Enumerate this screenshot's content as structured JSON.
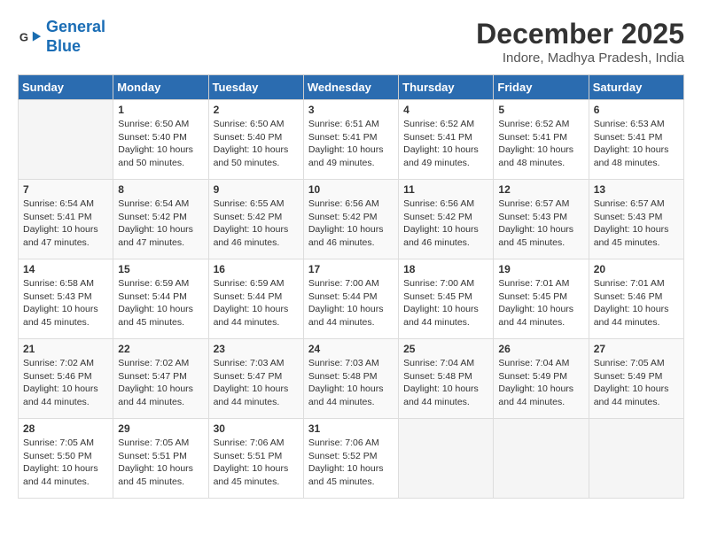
{
  "logo": {
    "line1": "General",
    "line2": "Blue"
  },
  "title": "December 2025",
  "subtitle": "Indore, Madhya Pradesh, India",
  "days_of_week": [
    "Sunday",
    "Monday",
    "Tuesday",
    "Wednesday",
    "Thursday",
    "Friday",
    "Saturday"
  ],
  "weeks": [
    [
      {
        "day": "",
        "info": ""
      },
      {
        "day": "1",
        "info": "Sunrise: 6:50 AM\nSunset: 5:40 PM\nDaylight: 10 hours\nand 50 minutes."
      },
      {
        "day": "2",
        "info": "Sunrise: 6:50 AM\nSunset: 5:40 PM\nDaylight: 10 hours\nand 50 minutes."
      },
      {
        "day": "3",
        "info": "Sunrise: 6:51 AM\nSunset: 5:41 PM\nDaylight: 10 hours\nand 49 minutes."
      },
      {
        "day": "4",
        "info": "Sunrise: 6:52 AM\nSunset: 5:41 PM\nDaylight: 10 hours\nand 49 minutes."
      },
      {
        "day": "5",
        "info": "Sunrise: 6:52 AM\nSunset: 5:41 PM\nDaylight: 10 hours\nand 48 minutes."
      },
      {
        "day": "6",
        "info": "Sunrise: 6:53 AM\nSunset: 5:41 PM\nDaylight: 10 hours\nand 48 minutes."
      }
    ],
    [
      {
        "day": "7",
        "info": "Sunrise: 6:54 AM\nSunset: 5:41 PM\nDaylight: 10 hours\nand 47 minutes."
      },
      {
        "day": "8",
        "info": "Sunrise: 6:54 AM\nSunset: 5:42 PM\nDaylight: 10 hours\nand 47 minutes."
      },
      {
        "day": "9",
        "info": "Sunrise: 6:55 AM\nSunset: 5:42 PM\nDaylight: 10 hours\nand 46 minutes."
      },
      {
        "day": "10",
        "info": "Sunrise: 6:56 AM\nSunset: 5:42 PM\nDaylight: 10 hours\nand 46 minutes."
      },
      {
        "day": "11",
        "info": "Sunrise: 6:56 AM\nSunset: 5:42 PM\nDaylight: 10 hours\nand 46 minutes."
      },
      {
        "day": "12",
        "info": "Sunrise: 6:57 AM\nSunset: 5:43 PM\nDaylight: 10 hours\nand 45 minutes."
      },
      {
        "day": "13",
        "info": "Sunrise: 6:57 AM\nSunset: 5:43 PM\nDaylight: 10 hours\nand 45 minutes."
      }
    ],
    [
      {
        "day": "14",
        "info": "Sunrise: 6:58 AM\nSunset: 5:43 PM\nDaylight: 10 hours\nand 45 minutes."
      },
      {
        "day": "15",
        "info": "Sunrise: 6:59 AM\nSunset: 5:44 PM\nDaylight: 10 hours\nand 45 minutes."
      },
      {
        "day": "16",
        "info": "Sunrise: 6:59 AM\nSunset: 5:44 PM\nDaylight: 10 hours\nand 44 minutes."
      },
      {
        "day": "17",
        "info": "Sunrise: 7:00 AM\nSunset: 5:44 PM\nDaylight: 10 hours\nand 44 minutes."
      },
      {
        "day": "18",
        "info": "Sunrise: 7:00 AM\nSunset: 5:45 PM\nDaylight: 10 hours\nand 44 minutes."
      },
      {
        "day": "19",
        "info": "Sunrise: 7:01 AM\nSunset: 5:45 PM\nDaylight: 10 hours\nand 44 minutes."
      },
      {
        "day": "20",
        "info": "Sunrise: 7:01 AM\nSunset: 5:46 PM\nDaylight: 10 hours\nand 44 minutes."
      }
    ],
    [
      {
        "day": "21",
        "info": "Sunrise: 7:02 AM\nSunset: 5:46 PM\nDaylight: 10 hours\nand 44 minutes."
      },
      {
        "day": "22",
        "info": "Sunrise: 7:02 AM\nSunset: 5:47 PM\nDaylight: 10 hours\nand 44 minutes."
      },
      {
        "day": "23",
        "info": "Sunrise: 7:03 AM\nSunset: 5:47 PM\nDaylight: 10 hours\nand 44 minutes."
      },
      {
        "day": "24",
        "info": "Sunrise: 7:03 AM\nSunset: 5:48 PM\nDaylight: 10 hours\nand 44 minutes."
      },
      {
        "day": "25",
        "info": "Sunrise: 7:04 AM\nSunset: 5:48 PM\nDaylight: 10 hours\nand 44 minutes."
      },
      {
        "day": "26",
        "info": "Sunrise: 7:04 AM\nSunset: 5:49 PM\nDaylight: 10 hours\nand 44 minutes."
      },
      {
        "day": "27",
        "info": "Sunrise: 7:05 AM\nSunset: 5:49 PM\nDaylight: 10 hours\nand 44 minutes."
      }
    ],
    [
      {
        "day": "28",
        "info": "Sunrise: 7:05 AM\nSunset: 5:50 PM\nDaylight: 10 hours\nand 44 minutes."
      },
      {
        "day": "29",
        "info": "Sunrise: 7:05 AM\nSunset: 5:51 PM\nDaylight: 10 hours\nand 45 minutes."
      },
      {
        "day": "30",
        "info": "Sunrise: 7:06 AM\nSunset: 5:51 PM\nDaylight: 10 hours\nand 45 minutes."
      },
      {
        "day": "31",
        "info": "Sunrise: 7:06 AM\nSunset: 5:52 PM\nDaylight: 10 hours\nand 45 minutes."
      },
      {
        "day": "",
        "info": ""
      },
      {
        "day": "",
        "info": ""
      },
      {
        "day": "",
        "info": ""
      }
    ]
  ]
}
